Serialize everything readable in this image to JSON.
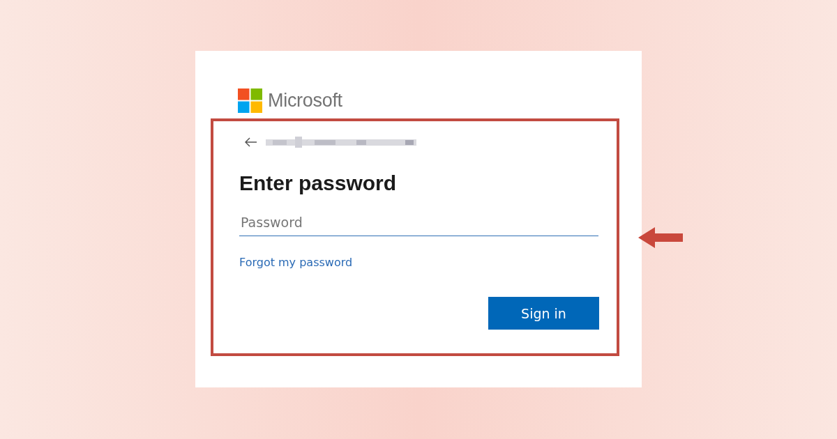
{
  "brand": {
    "name": "Microsoft"
  },
  "heading": "Enter password",
  "password_field": {
    "placeholder": "Password"
  },
  "link": "Forgot my password",
  "button": "Sign in"
}
